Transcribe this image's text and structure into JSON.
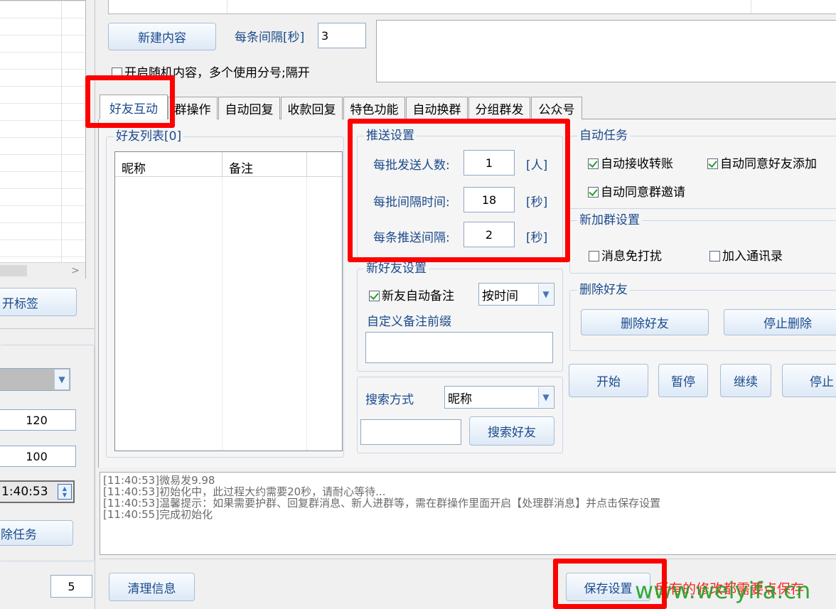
{
  "top": {
    "new_content_btn": "新建内容",
    "interval_label": "每条间隔[秒]",
    "interval_value": "3",
    "random_content_label": "开启随机内容，多个使用分号;隔开"
  },
  "tabs": [
    "好友互动",
    "群操作",
    "自动回复",
    "收款回复",
    "特色功能",
    "自动换群",
    "分组群发",
    "公众号"
  ],
  "friend_list": {
    "title": "好友列表[0]",
    "col_nickname": "昵称",
    "col_note": "备注"
  },
  "push_settings": {
    "title": "推送设置",
    "rows": [
      {
        "label": "每批发送人数:",
        "value": "1",
        "unit": "[人]"
      },
      {
        "label": "每批间隔时间:",
        "value": "18",
        "unit": "[秒]"
      },
      {
        "label": "每条推送间隔:",
        "value": "2",
        "unit": "[秒]"
      }
    ]
  },
  "auto_tasks": {
    "title": "自动任务",
    "items": [
      {
        "label": "自动接收转账",
        "checked": true
      },
      {
        "label": "自动同意好友添加",
        "checked": true
      },
      {
        "label": "自动同意群邀请",
        "checked": true
      }
    ]
  },
  "new_group": {
    "title": "新加群设置",
    "items": [
      {
        "label": "消息免打扰",
        "checked": false
      },
      {
        "label": "加入通讯录",
        "checked": false
      }
    ]
  },
  "new_friend": {
    "title": "新好友设置",
    "auto_note_label": "新友自动备注",
    "auto_note_checked": true,
    "note_mode": "按时间",
    "custom_prefix_label": "自定义备注前缀"
  },
  "delete_friend": {
    "title": "删除好友",
    "delete_btn": "删除好友",
    "stop_delete_btn": "停止删除"
  },
  "controls": {
    "start": "开始",
    "pause": "暂停",
    "resume": "继续",
    "stop": "停止"
  },
  "search": {
    "mode_label": "搜索方式",
    "mode_value": "昵称",
    "search_btn": "搜索好友"
  },
  "left_panel": {
    "open_tag_btn": "开标签",
    "value_120": "120",
    "value_100": "100",
    "time_value": "1:40:53",
    "task_btn": "除任务",
    "bottom_value": "5"
  },
  "log": [
    "[11:40:53]微易发9.98",
    "[11:40:53]初始化中，此过程大约需要20秒，请耐心等待...",
    "[11:40:53]温馨提示：如果需要护群、回复群消息、新人进群等，需在群操作里面开启【处理群消息】并点击保存设置",
    "[11:40:55]完成初始化"
  ],
  "bottom": {
    "clear_btn": "清理信息",
    "save_btn": "保存设置",
    "notice": "所有的修改都需要点保存",
    "watermark": "www.weiyifa.cn"
  },
  "colors": {
    "accent_text": "#1b4a8c",
    "highlight_red": "#ff0000",
    "watermark_green": "#22a022",
    "check_green": "#2d9c2d"
  }
}
